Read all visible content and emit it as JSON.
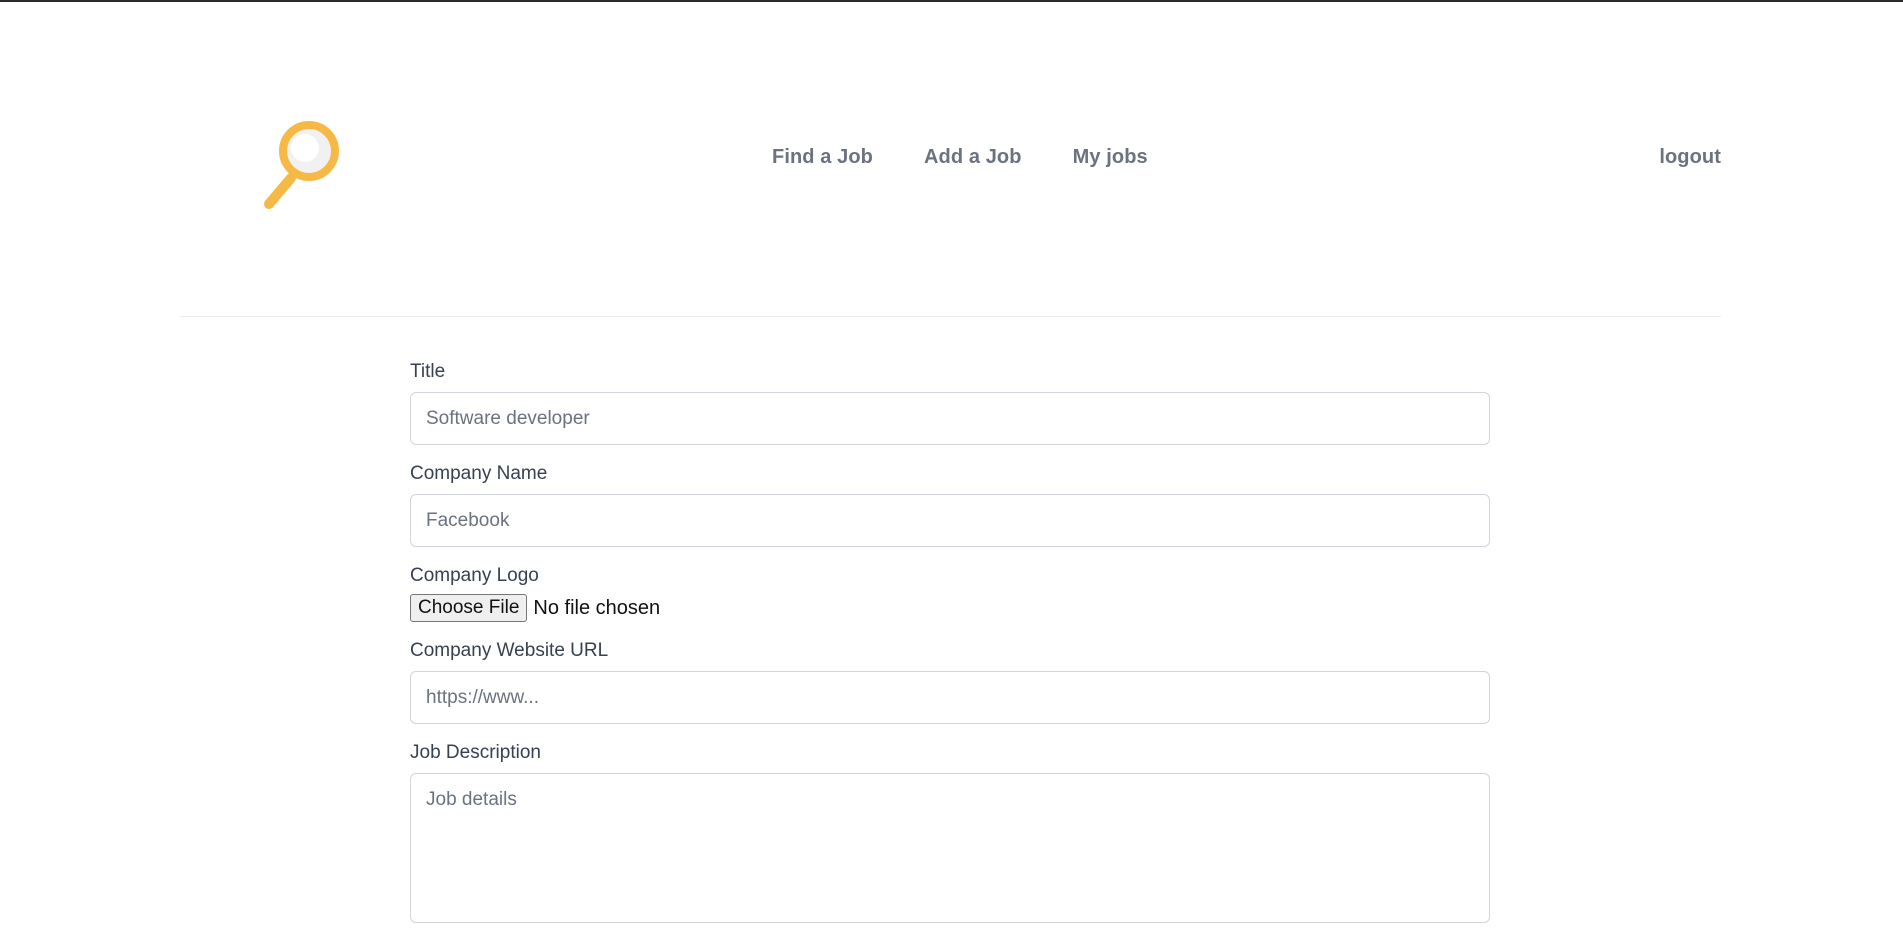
{
  "header": {
    "logo": {
      "icon": "magnifying-glass-icon",
      "accent_color": "#f7b946"
    },
    "nav": [
      {
        "label": "Find a Job"
      },
      {
        "label": "Add a Job"
      },
      {
        "label": "My jobs"
      }
    ],
    "logout_label": "logout"
  },
  "form": {
    "title": {
      "label": "Title",
      "placeholder": "Software developer"
    },
    "company_name": {
      "label": "Company Name",
      "placeholder": "Facebook"
    },
    "company_logo": {
      "label": "Company Logo",
      "button_label": "Choose File",
      "status": "No file chosen"
    },
    "company_website": {
      "label": "Company Website URL",
      "placeholder": "https://www..."
    },
    "job_description": {
      "label": "Job Description",
      "placeholder": "Job details"
    }
  }
}
